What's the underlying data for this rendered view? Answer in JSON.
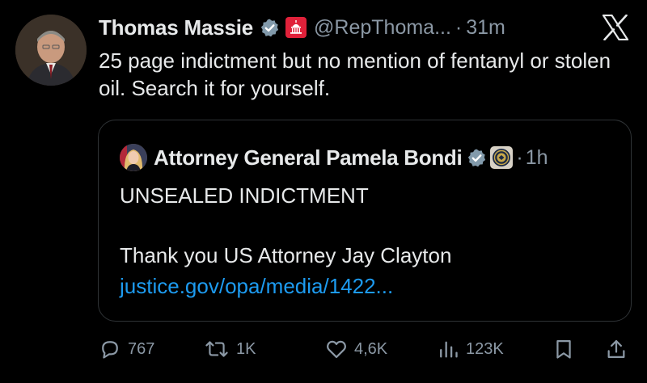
{
  "tweet": {
    "author_name": "Thomas Massie",
    "handle": "@RepThoma...",
    "separator": "·",
    "time": "31m",
    "text": "25 page indictment but no mention of fentanyl or stolen oil. Search it for yourself.",
    "verified_icon": "verified-badge-icon",
    "affiliation_icon": "capitol-affiliation-icon"
  },
  "quote": {
    "author_name": "Attorney General Pamela Bondi",
    "separator": "·",
    "time": "1h",
    "line1": "UNSEALED INDICTMENT",
    "line2": "Thank you US Attorney Jay Clayton",
    "link": "justice.gov/opa/media/1422...",
    "verified_icon": "verified-badge-icon",
    "affiliation_icon": "doj-seal-icon"
  },
  "actions": {
    "reply_count": "767",
    "retweet_count": "1K",
    "like_count": "4,6K",
    "view_count": "123K"
  },
  "colors": {
    "background": "#000000",
    "text": "#e7e9ea",
    "muted": "#8b98a5",
    "link": "#1d9bf0",
    "border": "#2f3336",
    "verified_badge": "#829aab",
    "affiliation_red": "#e0213a"
  }
}
